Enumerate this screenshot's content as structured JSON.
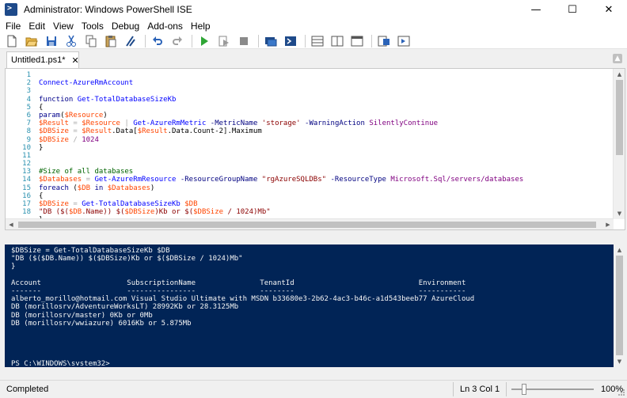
{
  "window": {
    "title": "Administrator: Windows PowerShell ISE",
    "minimize_glyph": "—",
    "maximize_glyph": "☐",
    "close_glyph": "✕"
  },
  "menu": [
    "File",
    "Edit",
    "View",
    "Tools",
    "Debug",
    "Add-ons",
    "Help"
  ],
  "toolbar": {
    "icons": [
      "new-script-icon",
      "open-icon",
      "save-icon",
      "cut-icon",
      "copy-icon",
      "paste-icon",
      "clear-console-icon",
      "undo-icon",
      "redo-icon",
      "run-script-icon",
      "run-selection-icon",
      "stop-icon",
      "new-remote-tab-icon",
      "start-powershell-icon",
      "show-script-pane-top-icon",
      "show-script-pane-right-icon",
      "show-script-pane-max-icon",
      "show-command-window-icon",
      "show-command-addon-icon"
    ]
  },
  "tab": {
    "label": "Untitled1.ps1*",
    "close_glyph": "✕"
  },
  "editor": {
    "line_numbers": [
      "1",
      "2",
      "3",
      "4",
      "5",
      "6",
      "7",
      "8",
      "9",
      "10",
      "11",
      "12",
      "13",
      "14",
      "15",
      "16",
      "17",
      "18"
    ],
    "lines": [
      [
        {
          "t": "",
          "c": "plain"
        }
      ],
      [
        {
          "t": "Connect-AzureRmAccount",
          "c": "cmd"
        }
      ],
      [
        {
          "t": "",
          "c": "plain"
        }
      ],
      [
        {
          "t": "function ",
          "c": "kw"
        },
        {
          "t": "Get-TotalDatabaseSizeKb",
          "c": "cmd"
        }
      ],
      [
        {
          "t": "{",
          "c": "plain"
        }
      ],
      [
        {
          "t": "param",
          "c": "kw"
        },
        {
          "t": "(",
          "c": "plain"
        },
        {
          "t": "$Resource",
          "c": "var"
        },
        {
          "t": ")",
          "c": "plain"
        }
      ],
      [
        {
          "t": "$Result",
          "c": "var"
        },
        {
          "t": " = ",
          "c": "op"
        },
        {
          "t": "$Resource",
          "c": "var"
        },
        {
          "t": " | ",
          "c": "op"
        },
        {
          "t": "Get-AzureRmMetric",
          "c": "cmd"
        },
        {
          "t": " -MetricName ",
          "c": "param"
        },
        {
          "t": "'storage'",
          "c": "str"
        },
        {
          "t": " -WarningAction ",
          "c": "param"
        },
        {
          "t": "SilentlyContinue",
          "c": "num"
        }
      ],
      [
        {
          "t": "$DBSize",
          "c": "var"
        },
        {
          "t": " = ",
          "c": "op"
        },
        {
          "t": "$Result",
          "c": "var"
        },
        {
          "t": ".Data[",
          "c": "plain"
        },
        {
          "t": "$Result",
          "c": "var"
        },
        {
          "t": ".Data.Count-2].Maximum",
          "c": "plain"
        }
      ],
      [
        {
          "t": "$DBSize",
          "c": "var"
        },
        {
          "t": " / ",
          "c": "op"
        },
        {
          "t": "1024",
          "c": "num"
        }
      ],
      [
        {
          "t": "}",
          "c": "plain"
        }
      ],
      [
        {
          "t": "",
          "c": "plain"
        }
      ],
      [
        {
          "t": "",
          "c": "plain"
        }
      ],
      [
        {
          "t": "#Size of all databases",
          "c": "cmt"
        }
      ],
      [
        {
          "t": "$Databases",
          "c": "var"
        },
        {
          "t": " = ",
          "c": "op"
        },
        {
          "t": "Get-AzureRmResource",
          "c": "cmd"
        },
        {
          "t": " -ResourceGroupName ",
          "c": "param"
        },
        {
          "t": "\"rgAzureSQLDBs\"",
          "c": "str"
        },
        {
          "t": " -ResourceType ",
          "c": "param"
        },
        {
          "t": "Microsoft.Sql/servers/databases",
          "c": "num"
        }
      ],
      [
        {
          "t": "foreach",
          "c": "kw"
        },
        {
          "t": " (",
          "c": "plain"
        },
        {
          "t": "$DB",
          "c": "var"
        },
        {
          "t": " in ",
          "c": "kw"
        },
        {
          "t": "$Databases",
          "c": "var"
        },
        {
          "t": ")",
          "c": "plain"
        }
      ],
      [
        {
          "t": "{",
          "c": "plain"
        }
      ],
      [
        {
          "t": "$DBSize",
          "c": "var"
        },
        {
          "t": " = ",
          "c": "op"
        },
        {
          "t": "Get-TotalDatabaseSizeKb",
          "c": "cmd"
        },
        {
          "t": " ",
          "c": "plain"
        },
        {
          "t": "$DB",
          "c": "var"
        }
      ],
      [
        {
          "t": "\"DB (",
          "c": "str"
        },
        {
          "t": "$(",
          "c": "str"
        },
        {
          "t": "$DB",
          "c": "var"
        },
        {
          "t": ".Name)) ",
          "c": "str"
        },
        {
          "t": "$(",
          "c": "str"
        },
        {
          "t": "$DBSize",
          "c": "var"
        },
        {
          "t": ")Kb or ",
          "c": "str"
        },
        {
          "t": "$(",
          "c": "str"
        },
        {
          "t": "$DBSize",
          "c": "var"
        },
        {
          "t": " / 1024)Mb\"",
          "c": "str"
        }
      ],
      [
        {
          "t": "}",
          "c": "plain"
        }
      ]
    ]
  },
  "console": {
    "lines": [
      "$DBSize = Get-TotalDatabaseSizeKb $DB",
      "\"DB ($($DB.Name)) $($DBSize)Kb or $($DBSize / 1024)Mb\"",
      "}",
      "",
      "Account                    SubscriptionName               TenantId                             Environment",
      "-------                    ----------------               --------                             -----------",
      "alberto_morillo@hotmail.com Visual Studio Ultimate with MSDN b33680e3-2b62-4ac3-b46c-a1d543beeb77 AzureCloud",
      "DB (morillosrv/AdventureWorksLT) 28992Kb or 28.3125Mb",
      "DB (morillosrv/master) 0Kb or 0Mb",
      "DB (morillosrv/wwiazure) 6016Kb or 5.875Mb",
      "",
      "",
      "",
      "",
      "PS C:\\WINDOWS\\system32>"
    ]
  },
  "status": {
    "text": "Completed",
    "position": "Ln 3  Col 1",
    "zoom": "100%"
  }
}
